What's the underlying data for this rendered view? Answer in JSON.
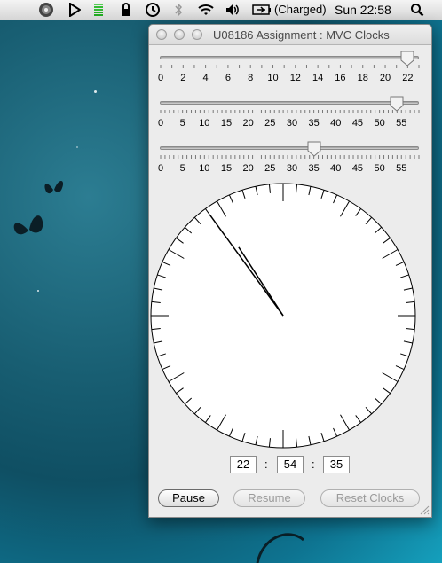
{
  "menubar": {
    "battery_status": "(Charged)",
    "clock": "Sun 22:58",
    "icons": [
      "dashboard-icon",
      "play-icon",
      "activity-meter-icon",
      "lock-icon",
      "time-machine-icon",
      "bluetooth-icon",
      "wifi-icon",
      "volume-icon",
      "battery-icon",
      "spotlight-icon"
    ]
  },
  "window": {
    "title": "U08186 Assignment : MVC Clocks",
    "sliders": [
      {
        "name": "hours",
        "value": 22,
        "min": 0,
        "max": 23,
        "labels": [
          "0",
          "2",
          "4",
          "6",
          "8",
          "10",
          "12",
          "14",
          "16",
          "18",
          "20",
          "22"
        ]
      },
      {
        "name": "minutes",
        "value": 54,
        "min": 0,
        "max": 59,
        "labels": [
          "0",
          "5",
          "10",
          "15",
          "20",
          "25",
          "30",
          "35",
          "40",
          "45",
          "50",
          "55"
        ]
      },
      {
        "name": "seconds",
        "value": 35,
        "min": 0,
        "max": 59,
        "labels": [
          "0",
          "5",
          "10",
          "15",
          "20",
          "25",
          "30",
          "35",
          "40",
          "45",
          "50",
          "55"
        ]
      }
    ],
    "time_fields": {
      "hours": "22",
      "minutes": "54",
      "seconds": "35"
    },
    "separators": [
      ":",
      ":"
    ],
    "buttons": {
      "pause": "Pause",
      "resume": "Resume",
      "reset": "Reset Clocks"
    }
  }
}
